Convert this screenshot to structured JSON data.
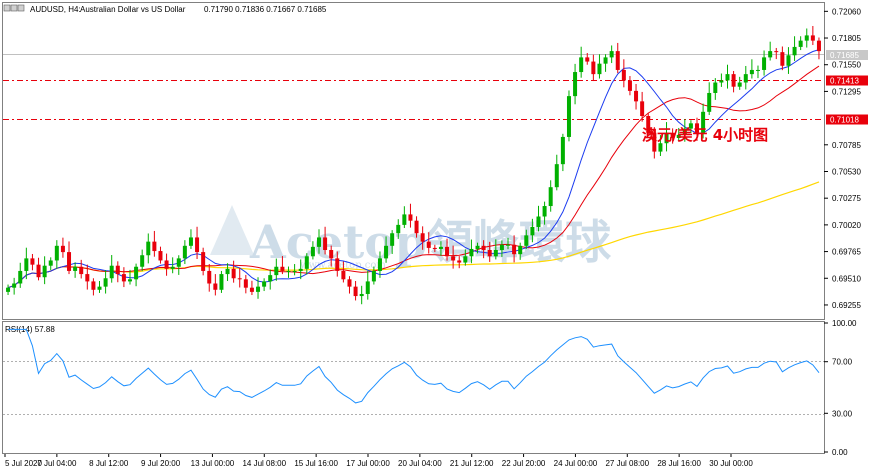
{
  "header": {
    "symbol": "AUDUSD, H4:",
    "description": "Australian Dollar vs US Dollar",
    "ohlc": "0.71790 0.71836 0.71667 0.71685"
  },
  "price_axis": {
    "ticks": [
      "0.72060",
      "0.71805",
      "0.71550",
      "0.71295",
      "0.70785",
      "0.70530",
      "0.70275",
      "0.70020",
      "0.69765",
      "0.69510",
      "0.69255"
    ],
    "labels": [
      {
        "text": "0.71685",
        "role": "current-price",
        "color": "#c0c0c0"
      },
      {
        "text": "0.71413",
        "role": "support-level",
        "color": "#e8000b"
      },
      {
        "text": "0.71018",
        "role": "support-level",
        "color": "#e8000b"
      }
    ]
  },
  "annotation": {
    "text": "澳元/美元 4小时图",
    "color": "#e8000b"
  },
  "watermark": {
    "text": "Acetop領峰環球",
    "url": "www.acetop.com"
  },
  "rsi": {
    "label": "RSI(14) 57.88",
    "ticks": [
      "100.00",
      "70.00",
      "30.00",
      "0.00"
    ]
  },
  "time_axis": [
    "5 Jul 2020",
    "7 Jul 04:00",
    "8 Jul 12:00",
    "9 Jul 20:00",
    "13 Jul 00:00",
    "14 Jul 08:00",
    "15 Jul 16:00",
    "17 Jul 00:00",
    "20 Jul 04:00",
    "21 Jul 12:00",
    "22 Jul 20:00",
    "24 Jul 00:00",
    "27 Jul 08:00",
    "28 Jul 16:00",
    "30 Jul 00:00"
  ],
  "colors": {
    "bull": "#00b000",
    "bear": "#e8000b",
    "ma_fast": "#1c3cf0",
    "ma_mid": "#e8000b",
    "ma_slow": "#ffd700",
    "rsi": "#1e90ff"
  },
  "chart_data": {
    "type": "candlestick",
    "series_close": [
      0.6942,
      0.6946,
      0.6958,
      0.697,
      0.6964,
      0.6952,
      0.6963,
      0.6968,
      0.6982,
      0.6976,
      0.6958,
      0.6962,
      0.6955,
      0.6948,
      0.694,
      0.6943,
      0.6951,
      0.6963,
      0.6955,
      0.6948,
      0.695,
      0.6962,
      0.6973,
      0.6986,
      0.6977,
      0.6968,
      0.696,
      0.6962,
      0.697,
      0.6982,
      0.699,
      0.6976,
      0.6958,
      0.6946,
      0.694,
      0.6955,
      0.696,
      0.6951,
      0.695,
      0.6942,
      0.6938,
      0.6943,
      0.6948,
      0.6954,
      0.6962,
      0.6958,
      0.6958,
      0.6958,
      0.696,
      0.6972,
      0.6981,
      0.699,
      0.6978,
      0.697,
      0.6958,
      0.695,
      0.6943,
      0.6934,
      0.6936,
      0.6948,
      0.6958,
      0.697,
      0.6982,
      0.6994,
      0.7002,
      0.7012,
      0.7006,
      0.6994,
      0.6986,
      0.698,
      0.6979,
      0.6981,
      0.6972,
      0.6968,
      0.6966,
      0.6972,
      0.6979,
      0.6982,
      0.6978,
      0.6972,
      0.6978,
      0.6983,
      0.6983,
      0.6974,
      0.6982,
      0.6992,
      0.7,
      0.701,
      0.702,
      0.7038,
      0.706,
      0.7086,
      0.7125,
      0.7148,
      0.7162,
      0.7158,
      0.7146,
      0.7156,
      0.7162,
      0.7168,
      0.715,
      0.714,
      0.713,
      0.712,
      0.7106,
      0.709,
      0.7072,
      0.708,
      0.709,
      0.7085,
      0.7088,
      0.7094,
      0.7099,
      0.709,
      0.711,
      0.7128,
      0.7138,
      0.714,
      0.7146,
      0.7134,
      0.7138,
      0.7146,
      0.715,
      0.715,
      0.7162,
      0.7168,
      0.7167,
      0.7154,
      0.7164,
      0.7172,
      0.7178,
      0.7183,
      0.7178,
      0.7168
    ],
    "ma_periods": [
      10,
      20,
      100
    ],
    "rsi_period": 14,
    "rsi_levels": [
      70,
      30
    ],
    "ylim": [
      0.6914,
      0.7213
    ]
  }
}
